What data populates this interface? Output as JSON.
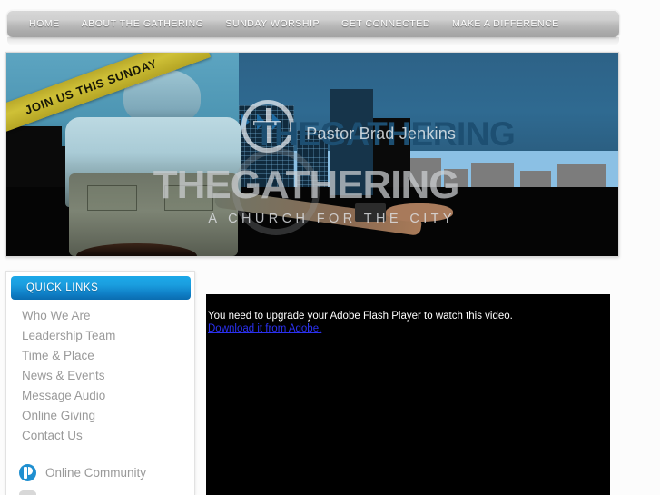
{
  "nav": {
    "items": [
      {
        "label": "HOME"
      },
      {
        "label": "ABOUT THE GATHERING"
      },
      {
        "label": "SUNDAY WORSHIP"
      },
      {
        "label": "GET CONNECTED"
      },
      {
        "label": "MAKE A DIFFERENCE"
      }
    ]
  },
  "hero": {
    "ribbon_text": "JOIN US THIS SUNDAY",
    "slide_a": {
      "wordmark": "THEGATHERING",
      "subtitle": "Pastor Brad Jenkins"
    },
    "slide_b": {
      "wordmark": "THEGATHERING",
      "tagline": "A CHURCH FOR THE CITY"
    }
  },
  "sidebar": {
    "title": "QUICK LINKS",
    "links": [
      {
        "label": "Who We Are"
      },
      {
        "label": "Leadership Team"
      },
      {
        "label": "Time & Place"
      },
      {
        "label": "News & Events"
      },
      {
        "label": "Message Audio"
      },
      {
        "label": "Online Giving"
      },
      {
        "label": "Contact Us"
      }
    ],
    "online_community": {
      "label": "Online Community",
      "icon": "online-community-icon"
    }
  },
  "video": {
    "message": "You need to upgrade your Adobe Flash Player to watch this video.",
    "link_label": "Download it from Adobe."
  },
  "colors": {
    "accent_blue": "#0f7fc6",
    "nav_gray": "#bdbdbd",
    "link_gray": "#9a9a9a",
    "ribbon_yellow": "#cfc137",
    "flash_link_blue": "#2b31f0"
  }
}
